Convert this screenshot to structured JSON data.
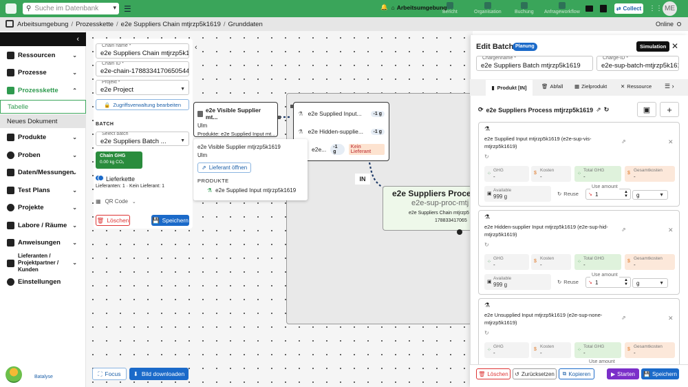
{
  "topbar": {
    "search_placeholder": "Suche im Datenbank",
    "workspace_label": "Arbeitsumgebung",
    "nav": [
      {
        "label": "Bericht"
      },
      {
        "label": "Organisation"
      },
      {
        "label": "Buchung"
      },
      {
        "label": "Anfrageworkflow"
      }
    ],
    "collect_label": "Collect",
    "avatar_initials": "ME"
  },
  "breadcrumb": {
    "items": [
      "Arbeitsumgebung",
      "Prozesskette",
      "e2e Suppliers Chain mtjrzp5k1619",
      "Grunddaten"
    ],
    "status": "Online"
  },
  "sidebar": {
    "items": [
      {
        "label": "Ressourcen"
      },
      {
        "label": "Prozesse"
      },
      {
        "label": "Prozesskette"
      },
      {
        "label": "Produkte"
      },
      {
        "label": "Proben"
      },
      {
        "label": "Daten/Messungen"
      },
      {
        "label": "Test Plans"
      },
      {
        "label": "Projekte"
      },
      {
        "label": "Labore / Räume"
      },
      {
        "label": "Anweisungen"
      },
      {
        "label": "Lieferanten / Projektpartner / Kunden"
      },
      {
        "label": "Einstellungen"
      }
    ],
    "sub": [
      "Tabelle",
      "Neues Dokument"
    ],
    "brand": "Batalyse"
  },
  "form": {
    "chain_name_label": "Chain name *",
    "chain_name": "e2e Suppliers Chain mtjrzp5k1619",
    "chain_id_label": "Chain ID *",
    "chain_id": "e2e-chain-1788334170650544",
    "project_label": "Projekt *",
    "project": "e2e Project",
    "access_button": "Zugriffsverwaltung bearbeiten",
    "batch_heading": "BATCH",
    "select_batch_label": "Select batch",
    "select_batch": "e2e Suppliers Batch ...",
    "ghg_title": "Chain GHG",
    "ghg_value": "0.00 kg CO₂",
    "toggle_label": "Lieferkette",
    "supplier_stats": "Lieferanten: 1 · Kein Lieferant: 1",
    "qr_label": "QR Code",
    "delete": "Löschen",
    "save": "Speichern"
  },
  "canvas": {
    "focus_button": "Focus",
    "download_button": "Bild downloaden",
    "supplier_node": {
      "title": "e2e Visible Supplier mt...",
      "city": "Ulm",
      "products": "Produkte: e2e Supplied Input mt..."
    },
    "inputs_node": {
      "items": [
        {
          "label": "e2e Supplied Input...",
          "badge": "-1 g"
        },
        {
          "label": "e2e Hidden-supplie...",
          "badge": "-1 g"
        },
        {
          "label": "e2e...",
          "badge": "-1 g",
          "extra": "Kein Lieferant"
        }
      ]
    },
    "edge_label": "IN",
    "process_node": {
      "title": "e2e Suppliers Proces",
      "subtitle": "e2e-sup-proc-mtj",
      "chain": "e2e Suppliers Chain mtjrzp5",
      "id": "178833417065"
    },
    "popup": {
      "title": "e2e Visible Supplier mtjrzp5k1619",
      "city": "Ulm",
      "open_button": "Lieferant öffnen",
      "products_heading": "PRODUKTE",
      "product": "e2e Supplied Input mtjrzp5k1619"
    }
  },
  "edit_batch": {
    "title": "Edit Batch",
    "badge": "Planung",
    "simulation": "Simulation",
    "name_label": "Chargenname *",
    "name": "e2e Suppliers Batch mtjrzp5k1619",
    "id_label": "Charge-ID *",
    "id": "e2e-sup-batch-mtjrzp5k1619",
    "tabs": [
      "Produkt [IN]",
      "Abfall",
      "Zielprodukt",
      "Ressource"
    ],
    "process_title": "e2e Suppliers Process mtjrzp5k1619",
    "cards": [
      {
        "title": "e2e Supplied Input mtjrzp5k1619 (e2e-sup-vis-mtjrzp5k1619)",
        "ghg": "-",
        "kosten": "-",
        "total_ghg": "-",
        "gesamt": "-",
        "available": "999 g",
        "use_amount": "1",
        "unit": "g"
      },
      {
        "title": "e2e Hidden-supplier Input mtjrzp5k1619 (e2e-sup-hid-mtjrzp5k1619)",
        "ghg": "-",
        "kosten": "-",
        "total_ghg": "-",
        "gesamt": "-",
        "available": "999 g",
        "use_amount": "1",
        "unit": "g"
      },
      {
        "title": "e2e Unsupplied Input mtjrzp5k1619 (e2e-sup-none-mtjrzp5k1619)",
        "ghg": "-",
        "kosten": "-",
        "total_ghg": "-",
        "gesamt": "-",
        "available": "",
        "use_amount": "",
        "unit": ""
      }
    ],
    "labels": {
      "ghg": "GHG",
      "kosten": "Kosten",
      "total_ghg": "Total GHG",
      "gesamt": "Gesamtkosten",
      "available": "Available",
      "reuse": "Reuse",
      "use_amount": "Use amount"
    },
    "footer": {
      "delete": "Löschen",
      "reset": "Zurücksetzen",
      "copy": "Kopieren",
      "start": "Starten",
      "save": "Speichern"
    }
  },
  "colors": {
    "brand_green": "#3aa55a",
    "primary_blue": "#1b6ac9",
    "purple": "#7b2fc9",
    "danger": "#d33"
  }
}
